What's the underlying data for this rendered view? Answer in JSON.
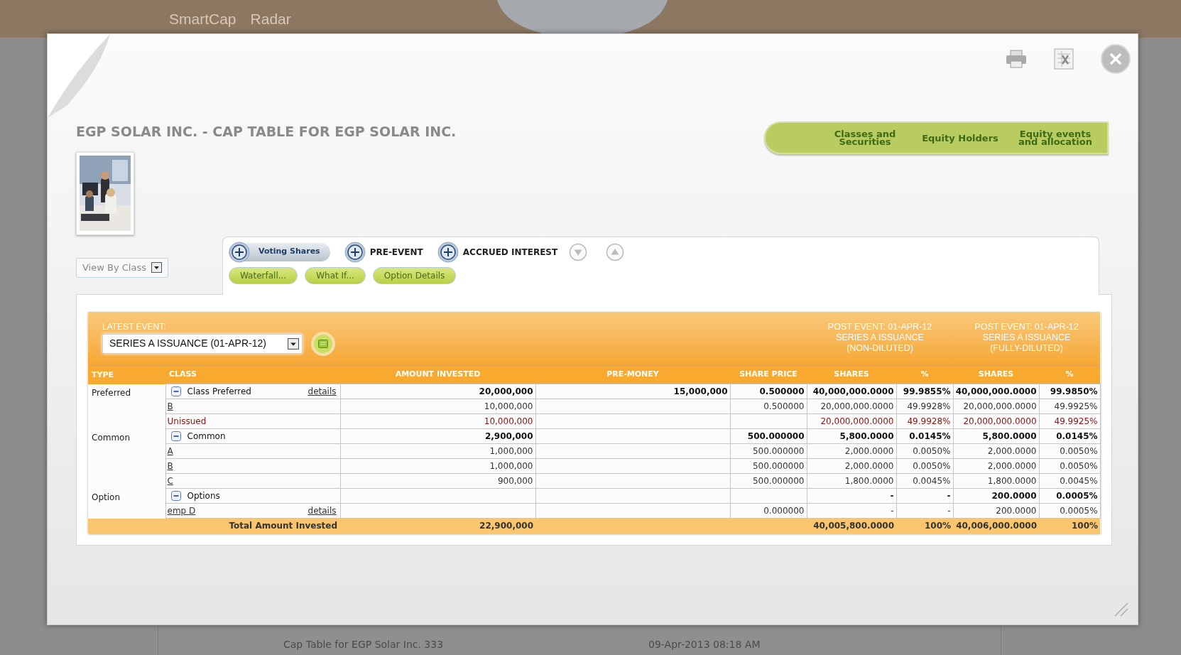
{
  "background": {
    "nav": [
      "SmartCap",
      "Radar"
    ],
    "list_rows": [
      {
        "title": "Cap Table for EGP Solar Inc. 333",
        "date": "09-Apr-2013 08:18 AM"
      }
    ]
  },
  "title": "EGP SOLAR INC. - CAP TABLE FOR EGP SOLAR INC.",
  "nav_tabs": [
    "Classes and Securities",
    "Equity Holders",
    "Equity events and allocation"
  ],
  "view_select": {
    "value": "View By Class"
  },
  "toggles": [
    {
      "label": "Voting Shares",
      "kind": "pill"
    },
    {
      "label": "PRE-EVENT",
      "kind": "plain"
    },
    {
      "label": "ACCRUED INTEREST",
      "kind": "plain"
    }
  ],
  "buttons": [
    "Waterfall...",
    "What If...",
    "Option Details"
  ],
  "event": {
    "label": "LATEST EVENT:",
    "value": "SERIES A ISSUANCE (01-APR-12)"
  },
  "post_events": [
    {
      "lines": [
        "POST EVENT: 01-APR-12",
        "SERIES A ISSUANCE",
        "(NON-DILUTED)"
      ]
    },
    {
      "lines": [
        "POST EVENT: 01-APR-12",
        "SERIES A ISSUANCE",
        "(FULLY-DILUTED)"
      ]
    }
  ],
  "table": {
    "columns": [
      "TYPE",
      "CLASS",
      "AMOUNT INVESTED",
      "PRE-MONEY",
      "SHARE PRICE",
      "SHARES",
      "%",
      "SHARES",
      "%"
    ],
    "groups": [
      {
        "type": "Preferred",
        "rows": [
          {
            "kind": "summary",
            "class": "Class Preferred",
            "expanded": true,
            "details": "details",
            "amount": "20,000,000",
            "pre_money": "15,000,000",
            "share_price": "0.500000",
            "shares": "40,000,000.0000",
            "pct": "99.9855%",
            "fd_shares": "40,000,000.0000",
            "fd_pct": "99.9850%"
          },
          {
            "kind": "item",
            "class": "B",
            "amount": "10,000,000",
            "share_price": "0.500000",
            "shares": "20,000,000.0000",
            "pct": "49.9928%",
            "fd_shares": "20,000,000.0000",
            "fd_pct": "49.9925%"
          },
          {
            "kind": "unissued",
            "class": "Unissued",
            "amount": "10,000,000",
            "shares": "20,000,000.0000",
            "pct": "49.9928%",
            "fd_shares": "20,000,000.0000",
            "fd_pct": "49.9925%"
          }
        ]
      },
      {
        "type": "Common",
        "rows": [
          {
            "kind": "summary",
            "class": "Common",
            "expanded": true,
            "amount": "2,900,000",
            "share_price": "500.000000",
            "shares": "5,800.0000",
            "pct": "0.0145%",
            "fd_shares": "5,800.0000",
            "fd_pct": "0.0145%"
          },
          {
            "kind": "item",
            "class": "A",
            "amount": "1,000,000",
            "share_price": "500.000000",
            "shares": "2,000.0000",
            "pct": "0.0050%",
            "fd_shares": "2,000.0000",
            "fd_pct": "0.0050%"
          },
          {
            "kind": "item",
            "class": "B",
            "amount": "1,000,000",
            "share_price": "500.000000",
            "shares": "2,000.0000",
            "pct": "0.0050%",
            "fd_shares": "2,000.0000",
            "fd_pct": "0.0050%"
          },
          {
            "kind": "item",
            "class": "C",
            "amount": "900,000",
            "share_price": "500.000000",
            "shares": "1,800.0000",
            "pct": "0.0045%",
            "fd_shares": "1,800.0000",
            "fd_pct": "0.0045%"
          }
        ]
      },
      {
        "type": "Option",
        "rows": [
          {
            "kind": "summary",
            "class": "Options",
            "expanded": true,
            "shares": "-",
            "pct": "-",
            "fd_shares": "200.0000",
            "fd_pct": "0.0005%"
          },
          {
            "kind": "item",
            "class": "emp D",
            "details": "details",
            "share_price": "0.000000",
            "shares": "-",
            "pct": "-",
            "fd_shares": "200.0000",
            "fd_pct": "0.0005%"
          }
        ]
      }
    ],
    "total": {
      "label": "Total Amount Invested",
      "amount": "22,900,000",
      "shares": "40,005,800.0000",
      "pct": "100%",
      "fd_shares": "40,006,000.0000",
      "fd_pct": "100%"
    }
  }
}
